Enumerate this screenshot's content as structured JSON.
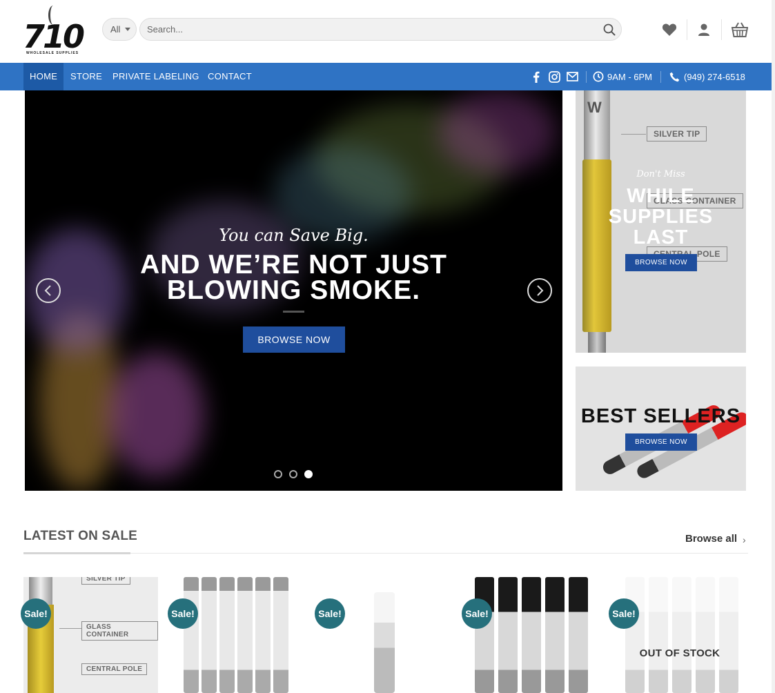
{
  "header": {
    "logo_text": "710",
    "logo_sub": "WHOLESALE SUPPLIES",
    "category_select": "All",
    "search_placeholder": "Search..."
  },
  "nav": {
    "items": [
      {
        "label": "Home"
      },
      {
        "label": "Store"
      },
      {
        "label": "Private Labeling"
      },
      {
        "label": "Contact"
      }
    ],
    "hours": "9AM - 6PM",
    "phone": "(949) 274-6518"
  },
  "hero": {
    "script": "You can Save Big.",
    "title_line1": "AND WE’RE NOT JUST",
    "title_line2": "BLOWING SMOKE.",
    "button": "BROWSE NOW",
    "active_slide": 3,
    "slide_count": 3
  },
  "banner_supplies": {
    "script": "Don't Miss",
    "title": "WHILE SUPPLIES LAST",
    "button": "BROWSE NOW",
    "diagram_labels": [
      "SILVER TIP",
      "GLASS CONTAINER",
      "CENTRAL POLE"
    ],
    "tip_letter": "W"
  },
  "banner_bestsellers": {
    "title": "BEST SELLERS",
    "button": "BROWSE NOW"
  },
  "latest": {
    "title": "LATEST ON SALE",
    "browse_all": "Browse all",
    "sale_badge": "Sale!",
    "out_of_stock": "OUT OF STOCK",
    "product1_labels": [
      "SILVER TIP",
      "GLASS CONTAINER",
      "CENTRAL POLE"
    ]
  },
  "colors": {
    "nav_bg": "#2f73c4",
    "nav_active": "#1d5aa6",
    "button_blue": "#1f4e9d",
    "sale_badge": "#26707c"
  }
}
